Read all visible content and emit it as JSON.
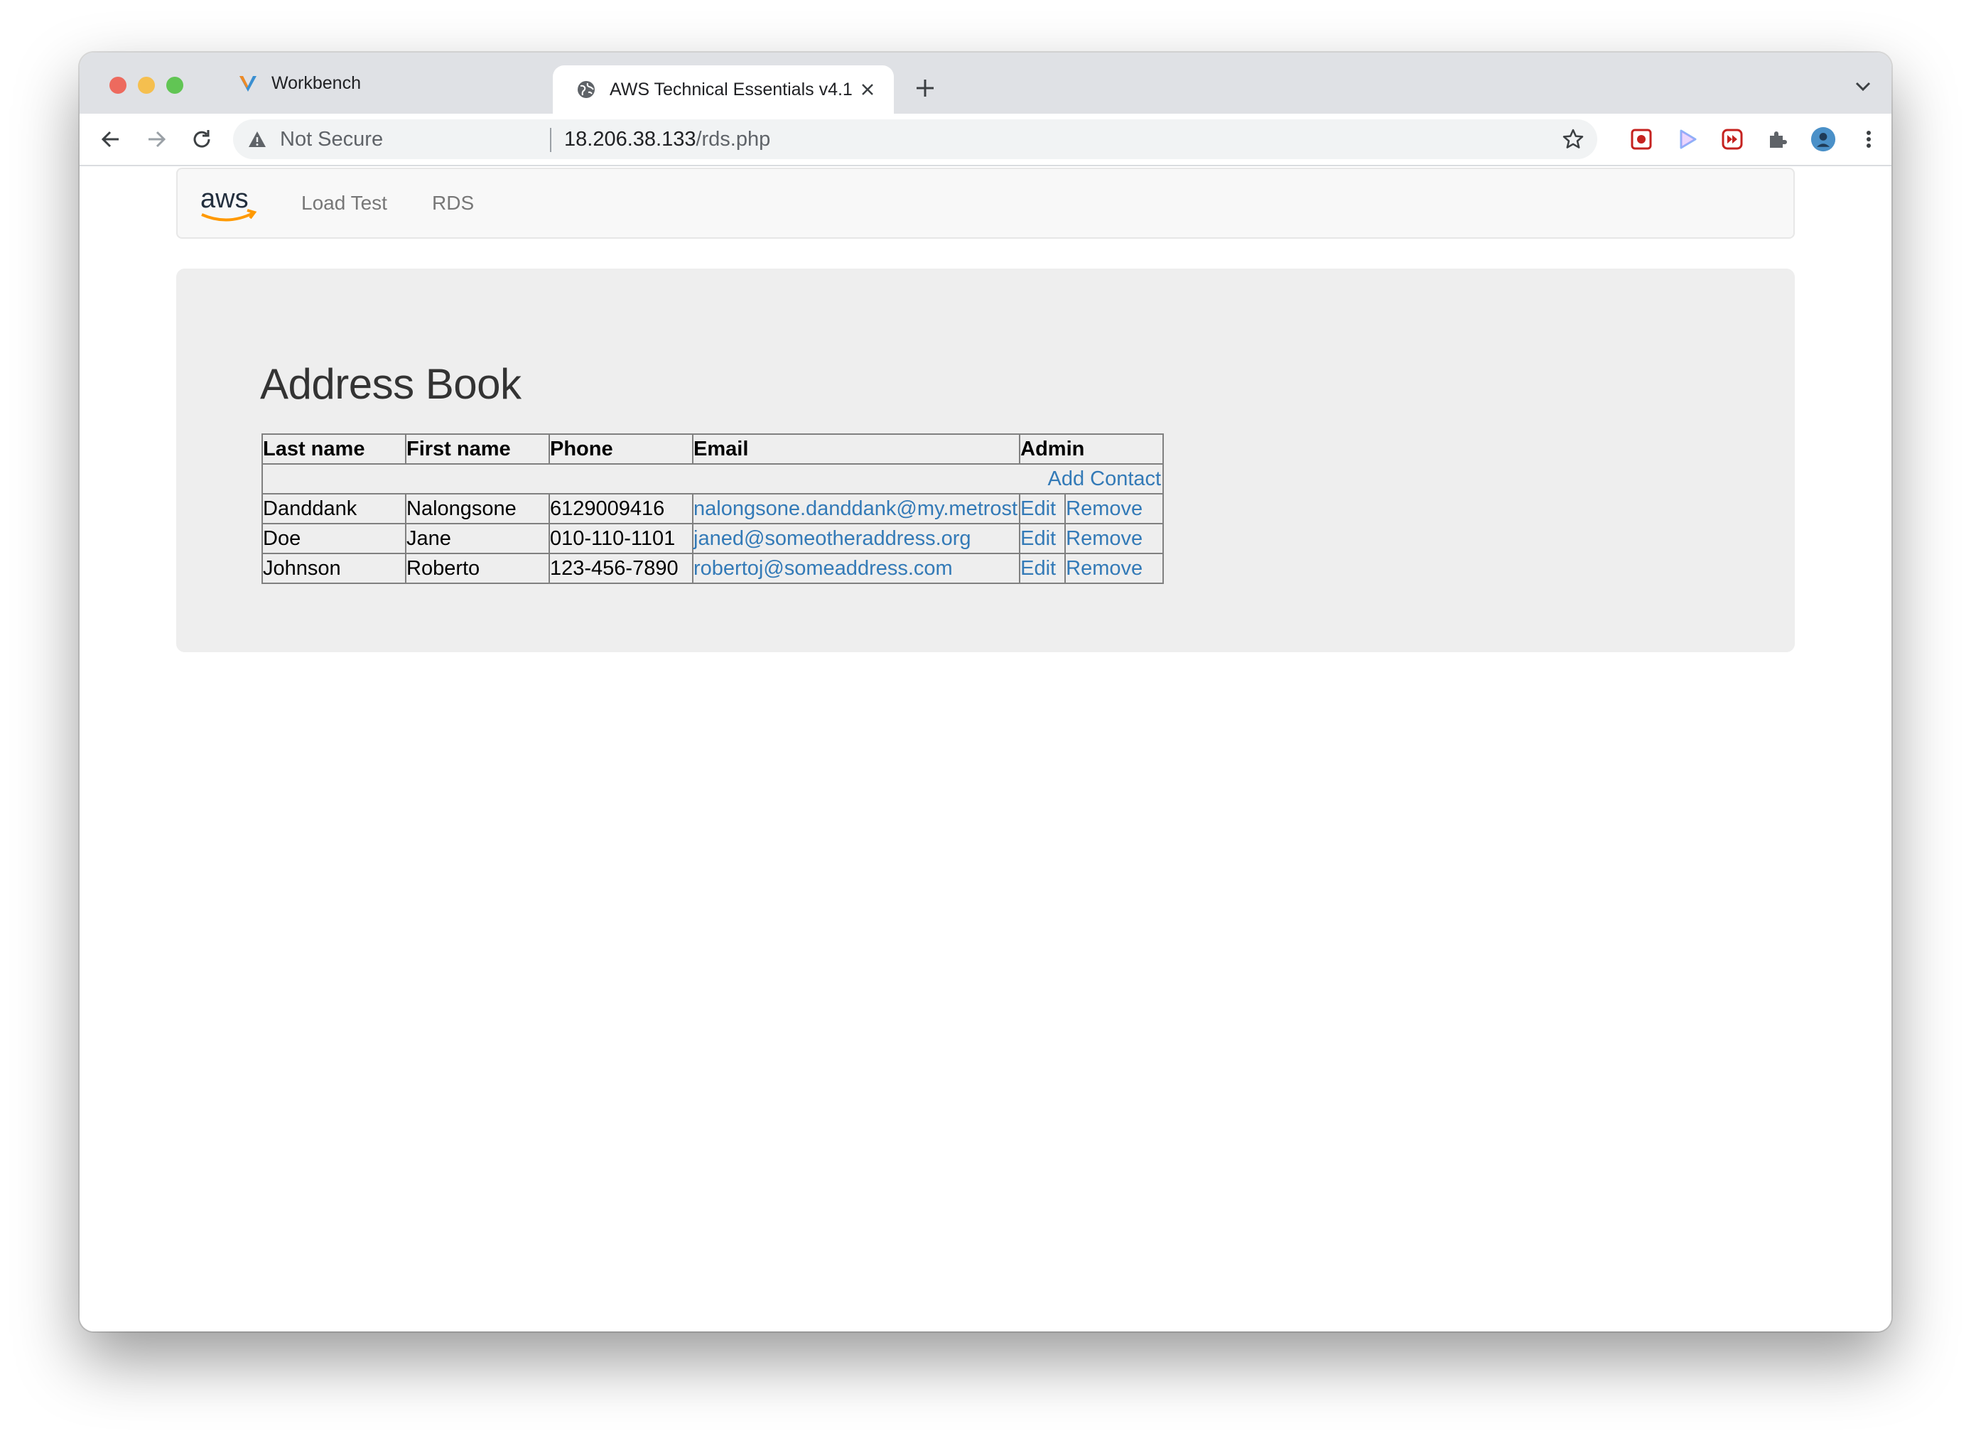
{
  "browser": {
    "tabs": [
      {
        "title": "Workbench",
        "favicon": "workbench-v-icon",
        "active": false
      },
      {
        "title": "AWS Technical Essentials v4.1",
        "favicon": "globe-icon",
        "active": true
      }
    ],
    "address_bar": {
      "security_label": "Not Secure",
      "url_host": "18.206.38.133",
      "url_path": "/rds.php"
    }
  },
  "nav": {
    "brand": "aws",
    "links": [
      "Load Test",
      "RDS"
    ]
  },
  "page": {
    "heading": "Address Book",
    "table": {
      "headers": [
        "Last name",
        "First name",
        "Phone",
        "Email",
        "Admin"
      ],
      "add_contact_label": "Add Contact",
      "rows": [
        {
          "last": "Danddank",
          "first": "Nalongsone",
          "phone": "6129009416",
          "email": "nalongsone.danddank@my.metrost",
          "edit": "Edit",
          "remove": "Remove"
        },
        {
          "last": "Doe",
          "first": "Jane",
          "phone": "010-110-1101",
          "email": "janed@someotheraddress.org",
          "edit": "Edit",
          "remove": "Remove"
        },
        {
          "last": "Johnson",
          "first": "Roberto",
          "phone": "123-456-7890",
          "email": "robertoj@someaddress.com",
          "edit": "Edit",
          "remove": "Remove"
        }
      ]
    }
  },
  "colors": {
    "link": "#337ab7",
    "aws_orange": "#ff9900",
    "jumbotron": "#eeeeee"
  }
}
